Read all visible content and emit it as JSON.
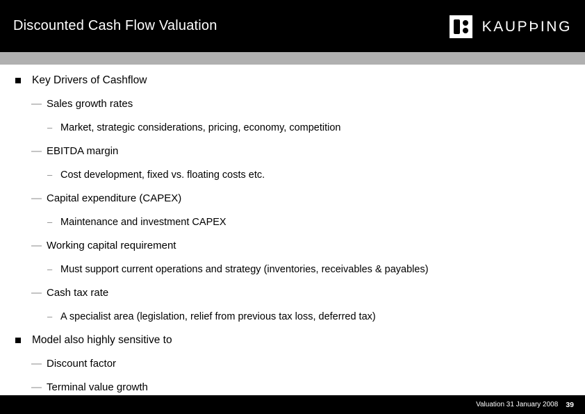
{
  "slide": {
    "title": "Discounted Cash Flow Valuation"
  },
  "brand": {
    "wordmark": "KAUPÞING",
    "logo_icon": "kaupthing-logo-icon",
    "background_color": "#000000",
    "foreground_color": "#ffffff",
    "accent_band_color": "#b0b0b0"
  },
  "body": {
    "bullets": [
      {
        "level": 1,
        "marker": "square",
        "text": "Key Drivers of Cashflow"
      },
      {
        "level": 2,
        "marker": "em-dash",
        "text": "Sales growth rates"
      },
      {
        "level": 3,
        "marker": "en-dash",
        "text": "Market, strategic considerations, pricing, economy, competition"
      },
      {
        "level": 2,
        "marker": "em-dash",
        "text": "EBITDA margin"
      },
      {
        "level": 3,
        "marker": "en-dash",
        "text": "Cost development, fixed vs. floating costs etc."
      },
      {
        "level": 2,
        "marker": "em-dash",
        "text": "Capital expenditure (CAPEX)"
      },
      {
        "level": 3,
        "marker": "en-dash",
        "text": "Maintenance and investment CAPEX"
      },
      {
        "level": 2,
        "marker": "em-dash",
        "text": "Working capital requirement"
      },
      {
        "level": 3,
        "marker": "en-dash",
        "text": "Must support current operations and strategy (inventories, receivables & payables)"
      },
      {
        "level": 2,
        "marker": "em-dash",
        "text": "Cash tax rate"
      },
      {
        "level": 3,
        "marker": "en-dash",
        "text": "A specialist area (legislation, relief from previous tax loss, deferred tax)"
      },
      {
        "level": 1,
        "marker": "square",
        "text": "Model also highly sensitive to"
      },
      {
        "level": 2,
        "marker": "em-dash",
        "text": "Discount factor"
      },
      {
        "level": 2,
        "marker": "em-dash",
        "text": "Terminal value growth"
      }
    ]
  },
  "footer": {
    "label": "Valuation 31 January 2008",
    "page_number": "39"
  }
}
